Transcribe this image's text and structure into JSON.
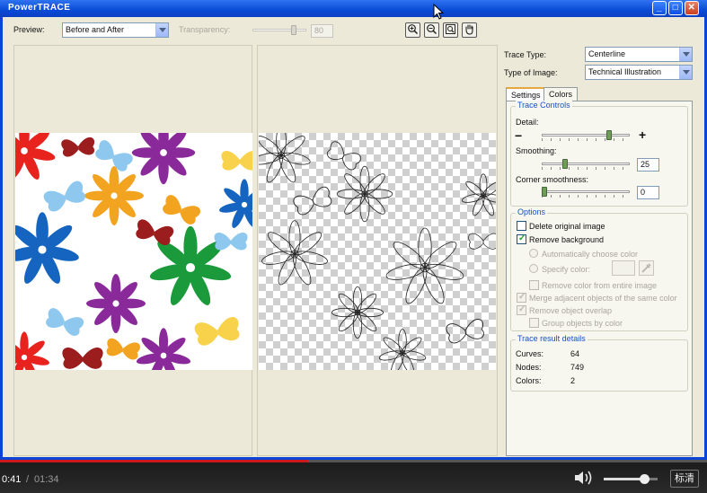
{
  "window": {
    "title": "PowerTRACE",
    "minimize_glyph": "_",
    "maximize_glyph": "□",
    "close_glyph": "✕"
  },
  "toolbar": {
    "preview_label": "Preview:",
    "preview_value": "Before and After",
    "transparency_label": "Transparency:",
    "transparency_value": "80",
    "transparency_level": 0.8
  },
  "panel": {
    "trace_type_label": "Trace Type:",
    "trace_type_value": "Centerline",
    "image_type_label": "Type of Image:",
    "image_type_value": "Technical Illustration",
    "tabs": [
      {
        "label": "Settings",
        "active": true
      },
      {
        "label": "Colors",
        "active": false
      }
    ],
    "trace_controls": {
      "title": "Trace Controls",
      "detail_label": "Detail:",
      "detail_level": 0.78,
      "minus_glyph": "−",
      "plus_glyph": "+",
      "smoothing_label": "Smoothing:",
      "smoothing_value": "25",
      "corner_label": "Corner smoothness:",
      "corner_value": "0"
    },
    "options": {
      "title": "Options",
      "delete_original": "Delete original image",
      "remove_background": "Remove background",
      "auto_choose": "Automatically choose color",
      "specify_color": "Specify color:",
      "remove_color_entire": "Remove color from entire image",
      "merge_adjacent": "Merge adjacent objects of the same color",
      "remove_overlap": "Remove object overlap",
      "group_by_color": "Group objects by color"
    },
    "result": {
      "title": "Trace result details",
      "curves_label": "Curves:",
      "curves_value": "64",
      "nodes_label": "Nodes:",
      "nodes_value": "749",
      "colors_label": "Colors:",
      "colors_value": "2"
    }
  },
  "video": {
    "current_time": "0:41",
    "separator": "/",
    "total_time": "01:34",
    "progress": 0.436,
    "volume_level": 0.75,
    "quality_label": "标清"
  },
  "colors": {
    "titlebar": "#0a4bd6",
    "flower_red": "#e8221c",
    "flower_purple": "#8a2a9a",
    "flower_blue": "#1565c0",
    "flower_green": "#1a9a3a",
    "flower_orange": "#f2a320",
    "butterfly_lightblue": "#8ec8ee",
    "butterfly_darkred": "#9b1d1d",
    "butterfly_yellow": "#f8d24a",
    "progress_red": "#cc181e"
  }
}
